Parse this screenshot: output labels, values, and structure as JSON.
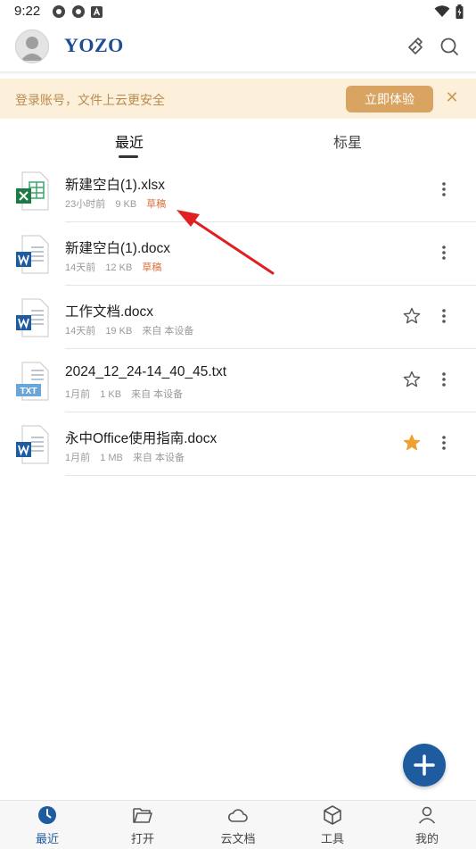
{
  "status_bar": {
    "time": "9:22"
  },
  "header": {
    "logo": "YOZO"
  },
  "banner": {
    "text": "登录账号，文件上云更安全",
    "button_label": "立即体验",
    "close_symbol": "✕"
  },
  "tabs": [
    {
      "label": "最近",
      "active": true
    },
    {
      "label": "标星",
      "active": false
    }
  ],
  "files": [
    {
      "name": "新建空白(1).xlsx",
      "time": "23小时前",
      "size": "9 KB",
      "draft_label": "草稿",
      "type": "xlsx",
      "starred": null
    },
    {
      "name": "新建空白(1).docx",
      "time": "14天前",
      "size": "12 KB",
      "draft_label": "草稿",
      "type": "docx",
      "starred": null
    },
    {
      "name": "工作文档.docx",
      "time": "14天前",
      "size": "19 KB",
      "source": "来自 本设备",
      "type": "docx",
      "starred": false
    },
    {
      "name": "2024_12_24-14_40_45.txt",
      "time": "1月前",
      "size": "1 KB",
      "source": "来自 本设备",
      "type": "txt",
      "starred": false
    },
    {
      "name": "永中Office使用指南.docx",
      "time": "1月前",
      "size": "1 MB",
      "source": "来自 本设备",
      "type": "docx",
      "starred": true
    }
  ],
  "bottom_nav": [
    {
      "label": "最近",
      "icon": "clock-icon",
      "active": true
    },
    {
      "label": "打开",
      "icon": "folder-icon",
      "active": false
    },
    {
      "label": "云文档",
      "icon": "cloud-icon",
      "active": false
    },
    {
      "label": "工具",
      "icon": "toolbox-icon",
      "active": false
    },
    {
      "label": "我的",
      "icon": "user-icon",
      "active": false
    }
  ],
  "colors": {
    "accent": "#1e5c9f",
    "banner_bg": "#fdf0db",
    "banner_button": "#d9a461",
    "draft": "#d8703b",
    "star_active": "#f0a030"
  }
}
